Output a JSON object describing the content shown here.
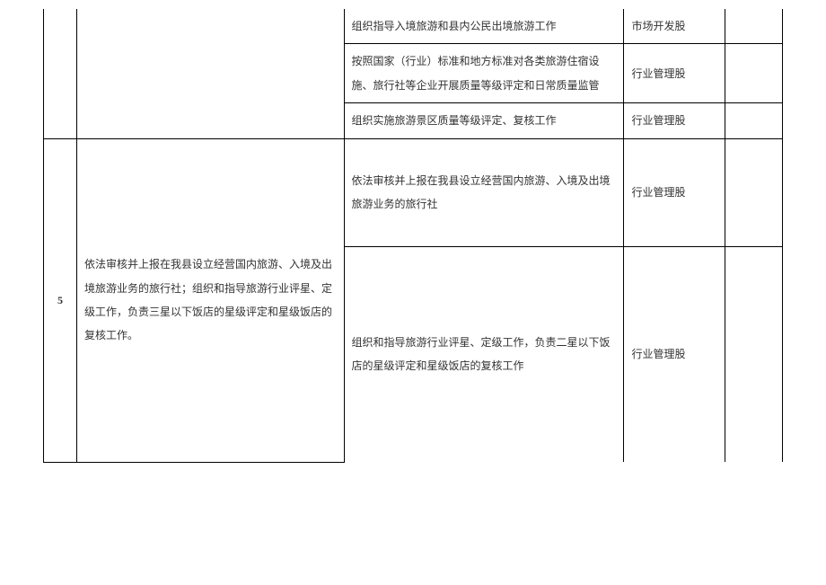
{
  "topSection": {
    "rows": [
      {
        "detail": "组织指导入境旅游和县内公民出境旅游工作",
        "dept": "市场开发股"
      },
      {
        "detail": "按照国家（行业）标准和地方标准对各类旅游住宿设施、旅行社等企业开展质量等级评定和日常质量监管",
        "dept": "行业管理股"
      },
      {
        "detail": "组织实施旅游景区质量等级评定、复核工作",
        "dept": "行业管理股"
      }
    ]
  },
  "row5": {
    "num": "5",
    "desc": "依法审核并上报在我县设立经营国内旅游、入境及出境旅游业务的旅行社；组织和指导旅游行业评星、定级工作，负责三星以下饭店的星级评定和星级饭店的复核工作。",
    "sub": [
      {
        "detail": "依法审核并上报在我县设立经营国内旅游、入境及出境旅游业务的旅行社",
        "dept": "行业管理股"
      },
      {
        "detail": "组织和指导旅游行业评星、定级工作，负责二星以下饭店的星级评定和星级饭店的复核工作",
        "dept": "行业管理股"
      }
    ]
  }
}
